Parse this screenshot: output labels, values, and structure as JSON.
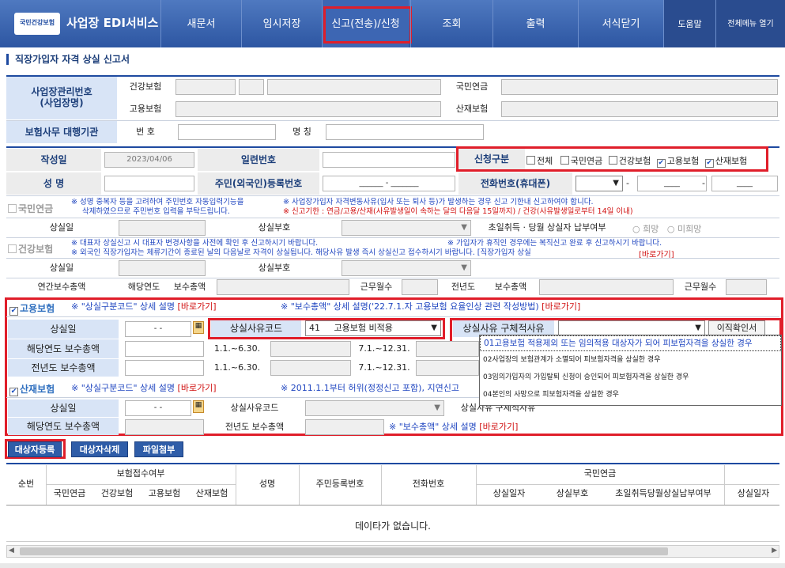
{
  "header": {
    "logo_badge": "국민건강보험",
    "app_title": "사업장 EDI서비스",
    "nav": [
      "새문서",
      "임시저장",
      "신고(전송)/신청",
      "조회",
      "출력",
      "서식닫기"
    ],
    "help": "도움말",
    "all_menu": "전체메뉴 열기"
  },
  "page_title": "직장가입자 자격 상실 신고서",
  "employer": {
    "mgmt_label": "사업장관리번호\n(사업장명)",
    "health": "건강보험",
    "employment": "고용보험",
    "pension": "국민연금",
    "industrial": "산재보험",
    "agent_label": "보험사무 대행기관",
    "num_label": "번 호",
    "name_label": "명 칭"
  },
  "form": {
    "created_label": "작성일",
    "created_value": "2023/04/06",
    "serial_label": "일련번호",
    "type_label": "신청구분",
    "types": [
      "전체",
      "국민연금",
      "건강보험",
      "고용보험",
      "산재보험"
    ],
    "name_label": "성 명",
    "rrn_label": "주민(외국인)등록번호",
    "rrn_value": "______ - _______",
    "phone_label": "전화번호(휴대폰)",
    "phone_dash1": "-",
    "phone_dash2": "-",
    "phone_mid": "____",
    "phone_end": "____"
  },
  "pension": {
    "title": "국민연금",
    "note1": "※ 성명 중복자 등을 고려하여 주민번호 자동입력기능을",
    "note2": "삭제하였으므로 주민번호 입력을 부탁드립니다.",
    "note3": "※ 사업장가입자 자격변동사유(입사 또는 퇴사 등)가 발생하는 경우 신고 기한내 신고하여야 합니다.",
    "note4": "※ 신고기한 : 연금/고용/산재(사유발생일이 속하는 달의 다음달 15일까지) / 건강(사유발생일로부터 14일 이내)",
    "loss_date": "상실일",
    "loss_code": "상실부호",
    "first_pay": "초일취득 · 당월 상실자 납부여부",
    "want": "희망",
    "not_want": "미희망"
  },
  "health": {
    "title": "건강보험",
    "note1": "※ 대표자 상실신고 시 대표자 변경사항을 사전에 확인 후 신고하시기 바랍니다.",
    "note2": "※ 외국인 직장가입자는 체류기간이 종료된 날의 다음날로 자격이 상실됩니다. 해당사유 발생 즉시 상실신고 접수하시기 바랍니다. [직장가입자 상실",
    "note3": "※ 가입자가 휴직인 경우에는 복직신고 완료 후 신고하시기 바랍니다.",
    "link": "[바로가기]",
    "loss_date": "상실일",
    "loss_code": "상실부호",
    "annual_total": "연간보수총액",
    "cur_year": "해당연도",
    "pay_total": "보수총액",
    "work_months": "근무월수",
    "prev_year": "전년도"
  },
  "employment": {
    "title": "고용보험",
    "note1": "※ \"상실구분코드\" 상세 설명",
    "note2": "※ \"보수총액\" 상세 설명('22.7.1.자 고용보험 요율인상 관련 작성방법)",
    "link": "[바로가기]",
    "loss_date": "상실일",
    "loss_date_value": "-  -",
    "reason_code": "상실사유코드",
    "code_num": "41",
    "code_name": "고용보험 비적용",
    "detail_reason": "상실사유 구체적사유",
    "transfer_btn": "이직확인서",
    "cur_pay": "해당연도 보수총액",
    "prev_pay": "전년도 보수총액",
    "p1": "1.1.~6.30.",
    "p2": "7.1.~12.31."
  },
  "dropdown": [
    "01고용보험 적용제외 또는 임의적용 대상자가 되어 피보험자격을 상실한 경우",
    "02사업장의 보험관계가 소멸되어 피보험자격을 상실한 경우",
    "03임의가입자의 가입탈퇴 신청이 승인되어 피보험자격을 상실한 경우",
    "04본인의 사망으로 피보험자격을 상실한 경우"
  ],
  "industrial": {
    "title": "산재보험",
    "note1": "※ \"상실구분코드\" 상세 설명",
    "note2": "※ 2011.1.1부터 허위(정정신고 포함), 지연신고",
    "link": "[바로가기]",
    "loss_date": "상실일",
    "loss_date_value": "-  -",
    "reason_code": "상실사유코드",
    "detail_reason": "상실사유 구체적사유",
    "cur_pay": "해당연도 보수총액",
    "prev_pay": "전년도 보수총액",
    "note3": "※ \"보수총액\" 상세 설명"
  },
  "buttons": {
    "register": "대상자등록",
    "delete": "대상자삭제",
    "attach": "파일첨부"
  },
  "table": {
    "seq": "순번",
    "insurance_status": "보험접수여부",
    "cols": [
      "국민연금",
      "건강보험",
      "고용보험",
      "산재보험"
    ],
    "name": "성명",
    "rrn": "주민등록번호",
    "phone": "전화번호",
    "pension": "국민연금",
    "p_cols": [
      "상실일자",
      "상실부호",
      "초일취득당월상실납부여부",
      "상실일자"
    ],
    "empty": "데이타가 없습니다."
  }
}
